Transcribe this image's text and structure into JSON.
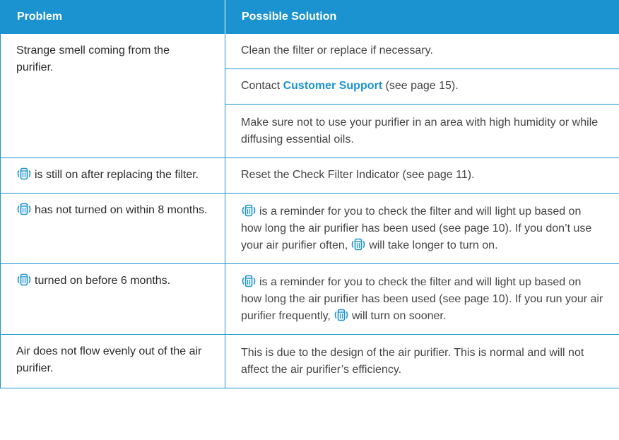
{
  "colors": {
    "accent": "#1b93d0",
    "header_text": "#ffffff",
    "body_text": "#444444"
  },
  "header": {
    "problem": "Problem",
    "solution": "Possible Solution"
  },
  "icon": "filter-indicator-icon",
  "rows": [
    {
      "problem": "Strange smell coming from the purifier.",
      "solutions": [
        "Clean the filter or replace if necessary.",
        {
          "before": "Contact ",
          "link": "Customer Support",
          "after": " (see page 15)."
        },
        "Make sure not to use your purifier in an area with high humidity or while diffusing essential oils."
      ]
    },
    {
      "problem": "is still on after replacing the filter.",
      "solution": "Reset the Check Filter Indicator (see page 11)."
    },
    {
      "problem": "has not turned on within 8 months.",
      "solution_a": "is a reminder for you to check the filter and will light up based on how long the air purifier has been used (see page 10). If you don’t use your air purifier often,",
      "solution_b": "will take longer to turn on."
    },
    {
      "problem": "turned on before 6 months.",
      "solution_a": "is a reminder for you to check the filter and will light up based on how long the air purifier has been used (see page 10). If you run your air purifier frequently,",
      "solution_b": "will turn on sooner."
    },
    {
      "problem": "Air does not flow evenly out of the air purifier.",
      "solution": "This is due to the design of the air purifier. This is normal and will not affect the air purifier’s efficiency."
    }
  ]
}
